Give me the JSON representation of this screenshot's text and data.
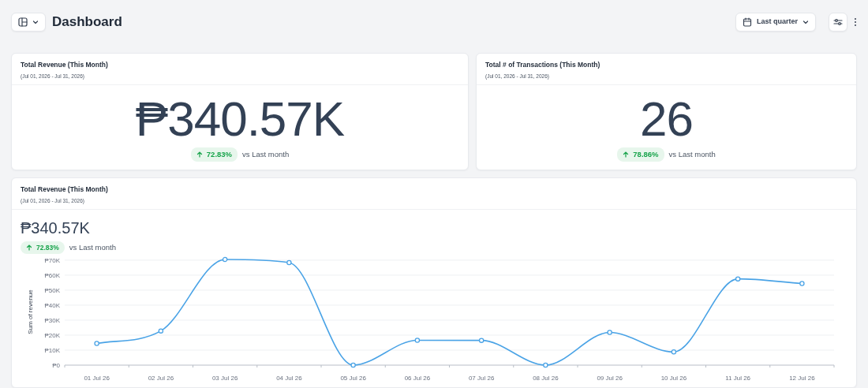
{
  "header": {
    "title": "Dashboard",
    "date_range": "Last quarter"
  },
  "kpis": [
    {
      "title": "Total Revenue (This Month)",
      "subtitle": "(Jul 01, 2026 - Jul 31, 2026)",
      "value": "₱340.57K",
      "delta": "72.83%",
      "increase": true,
      "comparison": "vs Last month"
    },
    {
      "title": "Total # of Transactions (This Month)",
      "subtitle": "(Jul 01, 2026 - Jul 31, 2026)",
      "value": "26",
      "delta": "78.86%",
      "increase": true,
      "comparison": "vs Last month"
    }
  ],
  "trend": {
    "title": "Total Revenue (This Month)",
    "subtitle": "(Jul 01, 2026 - Jul 31, 2026)",
    "value": "₱340.57K",
    "delta": "72.83%",
    "increase": true,
    "comparison": "vs Last month",
    "chart_data": {
      "type": "line",
      "ylabel": "Sum of revenue",
      "categories": [
        "01 Jul 26",
        "02 Jul 26",
        "03 Jul 26",
        "04 Jul 26",
        "05 Jul 26",
        "06 Jul 26",
        "07 Jul 26",
        "08 Jul 26",
        "09 Jul 26",
        "10 Jul 26",
        "11 Jul 26",
        "12 Jul 26"
      ],
      "grid": true,
      "marker": true,
      "series": [
        {
          "color": "#4aa3e6",
          "values": [
            14500,
            22800,
            70500,
            68400,
            0,
            16600,
            16500,
            0,
            21800,
            8800,
            57500,
            54400
          ]
        }
      ],
      "ylim": [
        0,
        71000
      ],
      "yticks": [
        {
          "value": 0,
          "label": "₱0"
        },
        {
          "value": 10000,
          "label": "₱10K"
        },
        {
          "value": 20000,
          "label": "₱20K"
        },
        {
          "value": 30000,
          "label": "₱30K"
        },
        {
          "value": 40000,
          "label": "₱40K"
        },
        {
          "value": 50000,
          "label": "₱50K"
        },
        {
          "value": 60000,
          "label": "₱60K"
        },
        {
          "value": 70000,
          "label": "₱70K"
        }
      ]
    }
  }
}
